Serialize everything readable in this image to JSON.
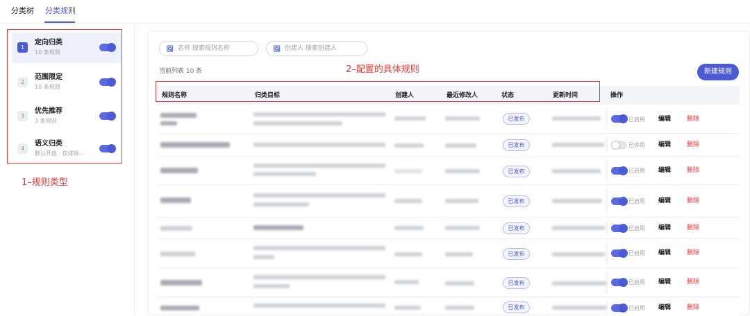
{
  "tabs": [
    "分类树",
    "分类规则"
  ],
  "rule_types": [
    {
      "num": "1",
      "name": "定向归类",
      "sub": "10 条规则"
    },
    {
      "num": "2",
      "name": "范围限定",
      "sub": "10 条规则"
    },
    {
      "num": "3",
      "name": "优先推荐",
      "sub": "3 条规则"
    },
    {
      "num": "4",
      "name": "语义归类",
      "sub": "默认开启 · 仅排除..."
    }
  ],
  "annotations": {
    "left": "1–规则类型",
    "top": "2–配置的具体规则"
  },
  "search": {
    "name": "名称  搜索规则名称",
    "creator": "创建人  搜索创建人"
  },
  "count_text": "当前列表 10 条",
  "new_button": "新建规则",
  "columns": [
    "规则名称",
    "归类目标",
    "创建人",
    "最近修改人",
    "状态",
    "更新时间",
    "操作"
  ],
  "rows": [
    {
      "status": "已发布",
      "enabled": "已启用",
      "edit": "编辑",
      "delete": "删除"
    },
    {
      "status": "已发布",
      "enabled": "已停用",
      "edit": "编辑",
      "delete": "删除"
    },
    {
      "status": "已发布",
      "enabled": "已启用",
      "edit": "编辑",
      "delete": "删除"
    },
    {
      "status": "已发布",
      "enabled": "已启用",
      "edit": "编辑",
      "delete": "删除"
    },
    {
      "status": "已发布",
      "enabled": "已启用",
      "edit": "编辑",
      "delete": "删除"
    },
    {
      "status": "已发布",
      "enabled": "已启用",
      "edit": "编辑",
      "delete": "删除"
    },
    {
      "status": "已发布",
      "enabled": "已启用",
      "edit": "编辑",
      "delete": "删除"
    },
    {
      "status": "已发布",
      "enabled": "已启用",
      "edit": "编辑",
      "delete": "删除"
    }
  ],
  "colors": {
    "accent": "#4b5bd6",
    "danger": "#e53935",
    "annotation": "#e53935"
  },
  "icons": [
    "search-icon"
  ]
}
